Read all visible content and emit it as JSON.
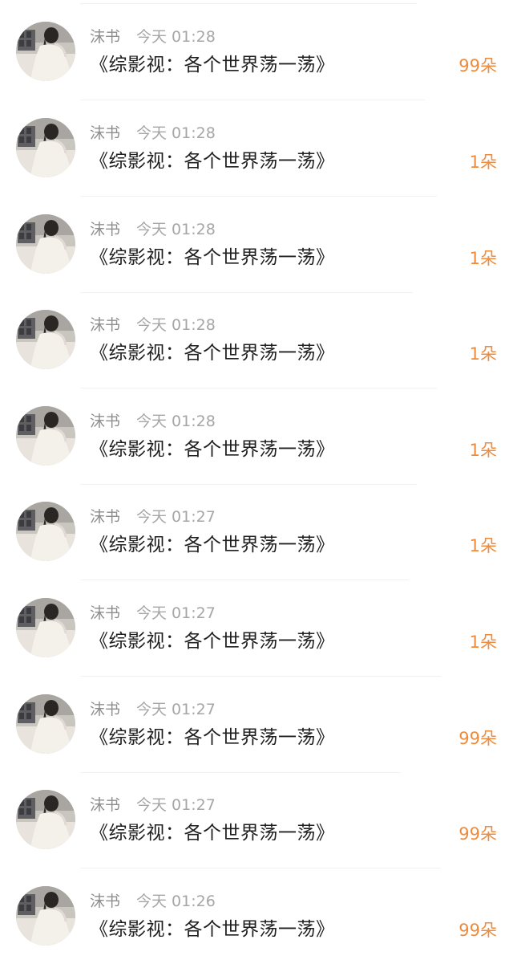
{
  "rows": [
    {
      "name": "沫书",
      "time": "今天 01:28",
      "message": "《综影视：各个世界荡一荡》",
      "gift": "99朵"
    },
    {
      "name": "沫书",
      "time": "今天 01:28",
      "message": "《综影视：各个世界荡一荡》",
      "gift": "1朵"
    },
    {
      "name": "沫书",
      "time": "今天 01:28",
      "message": "《综影视：各个世界荡一荡》",
      "gift": "1朵"
    },
    {
      "name": "沫书",
      "time": "今天 01:28",
      "message": "《综影视：各个世界荡一荡》",
      "gift": "1朵"
    },
    {
      "name": "沫书",
      "time": "今天 01:28",
      "message": "《综影视：各个世界荡一荡》",
      "gift": "1朵"
    },
    {
      "name": "沫书",
      "time": "今天 01:27",
      "message": "《综影视：各个世界荡一荡》",
      "gift": "1朵"
    },
    {
      "name": "沫书",
      "time": "今天 01:27",
      "message": "《综影视：各个世界荡一荡》",
      "gift": "1朵"
    },
    {
      "name": "沫书",
      "time": "今天 01:27",
      "message": "《综影视：各个世界荡一荡》",
      "gift": "99朵"
    },
    {
      "name": "沫书",
      "time": "今天 01:27",
      "message": "《综影视：各个世界荡一荡》",
      "gift": "99朵"
    },
    {
      "name": "沫书",
      "time": "今天 01:26",
      "message": "《综影视：各个世界荡一荡》",
      "gift": "99朵"
    }
  ],
  "colors": {
    "gift": "#ef8b3b",
    "name": "#8e8e8e",
    "message": "#1f1f1f"
  },
  "icons": {
    "avatar": "user-avatar-photo"
  }
}
